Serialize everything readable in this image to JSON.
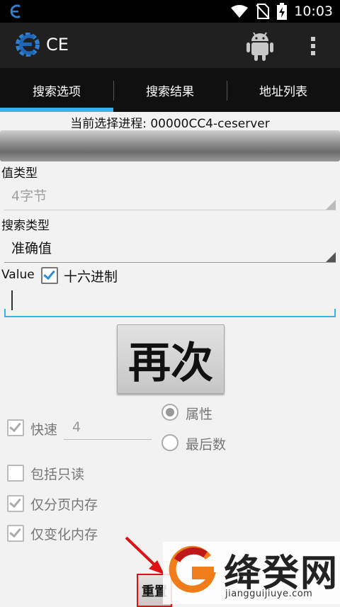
{
  "status_bar": {
    "time": "10:03"
  },
  "app": {
    "title": "CE"
  },
  "tabs": [
    {
      "label": "搜索选项",
      "active": true
    },
    {
      "label": "搜索结果",
      "active": false
    },
    {
      "label": "地址列表",
      "active": false
    }
  ],
  "process": {
    "label": "当前选择进程: 00000CC4-ceserver"
  },
  "value_type": {
    "label": "值类型",
    "selected": "4字节"
  },
  "search_type": {
    "label": "搜索类型",
    "selected": "准确值"
  },
  "value": {
    "label": "Value",
    "hex_label": "十六进制",
    "hex_checked": true,
    "input_value": ""
  },
  "scan_button": {
    "label": "再次"
  },
  "options": {
    "fast": {
      "label": "快速",
      "checked": true,
      "value": "4"
    },
    "radio_attribute": {
      "label": "属性",
      "selected": true
    },
    "radio_last_digits": {
      "label": "最后数",
      "selected": false
    },
    "include_readonly": {
      "label": "包括只读",
      "checked": false
    },
    "paged_only": {
      "label": "仅分页内存",
      "checked": true
    },
    "changed_only": {
      "label": "仅变化内存",
      "checked": true
    }
  },
  "reset_button": {
    "label": "重置"
  },
  "watermark": {
    "title": "绛癸网",
    "url": "jiangguijiuye.com"
  },
  "colors": {
    "accent": "#33b5e5",
    "actionbar": "#202020",
    "tabbar": "#101010",
    "highlight": "#dd1111"
  }
}
